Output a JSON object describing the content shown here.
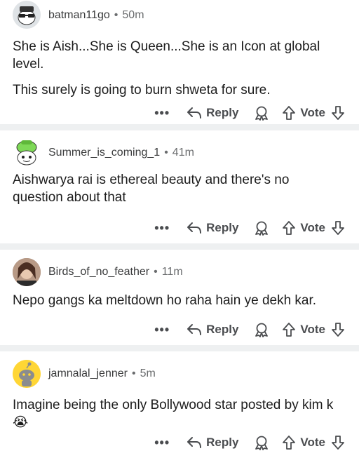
{
  "comments": [
    {
      "author": "batman11go",
      "time": "50m",
      "paragraphs": [
        "She is Aish...She is Queen...She is an Icon at global level.",
        "This surely is going to burn shweta for sure."
      ],
      "avatar_icon": "sunglasses-snoo-avatar"
    },
    {
      "author": "Summer_is_coming_1",
      "time": "41m",
      "paragraphs": [
        "Aishwarya rai is ethereal beauty and there's no question about that"
      ],
      "avatar_icon": "green-hat-snoo-avatar"
    },
    {
      "author": "Birds_of_no_feather",
      "time": "11m",
      "paragraphs": [
        "Nepo gangs ka meltdown ho raha hain ye dekh kar."
      ],
      "avatar_icon": "photo-avatar"
    },
    {
      "author": "jamnalal_jenner",
      "time": "5m",
      "paragraphs": [
        "Imagine being the only Bollywood star posted by kim k 😭"
      ],
      "avatar_icon": "yellow-snoo-avatar"
    }
  ],
  "actions": {
    "more": "•••",
    "reply": "Reply",
    "vote": "Vote"
  },
  "separator": "•",
  "colors": {
    "divider": "#eef0f1",
    "meta_text": "#6a6c6e",
    "action_text": "#4a4c4f"
  }
}
